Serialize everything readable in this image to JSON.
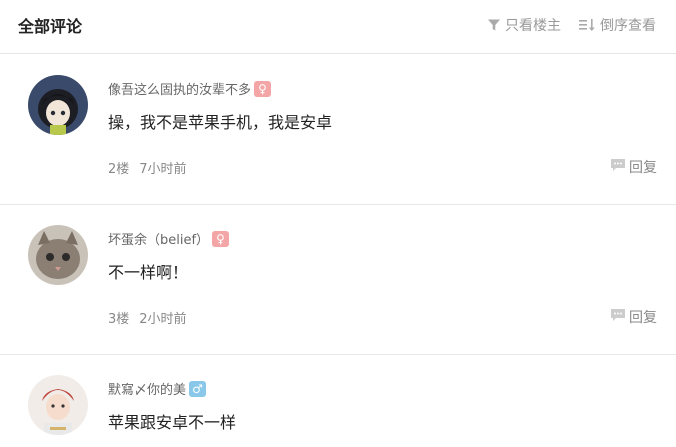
{
  "header": {
    "title": "全部评论",
    "filter_label": "只看楼主",
    "sort_label": "倒序查看"
  },
  "comments": [
    {
      "username": "像吾这么固执的汝辈不多",
      "gender": "female",
      "gender_icon": "female-icon",
      "content": "操，我不是苹果手机，我是安卓",
      "floor": "2楼",
      "time": "7小时前",
      "reply_label": "回复"
    },
    {
      "username": "坏蛋余（belief）",
      "gender": "female",
      "gender_icon": "female-icon",
      "content": "不一样啊！",
      "floor": "3楼",
      "time": "2小时前",
      "reply_label": "回复"
    },
    {
      "username": "默寫〆你的美",
      "gender": "male",
      "gender_icon": "male-icon",
      "content": "苹果跟安卓不一样"
    }
  ],
  "colors": {
    "female_badge": "#f4a6a6",
    "male_badge": "#8ac8ea",
    "muted_text": "#888888"
  }
}
